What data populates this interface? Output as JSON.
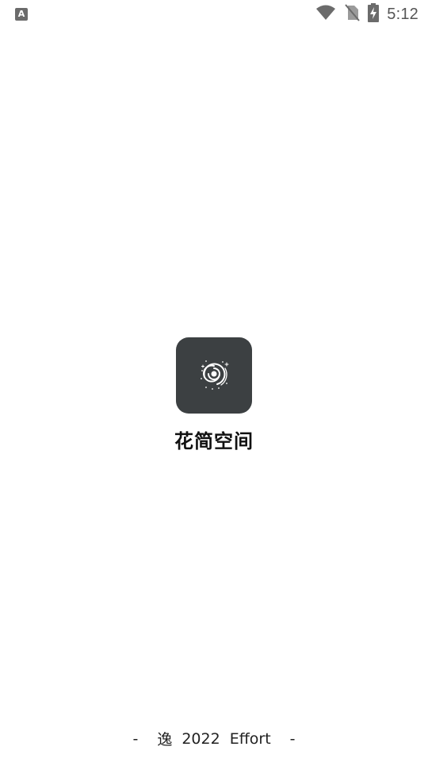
{
  "status_bar": {
    "left_icon_letter": "A",
    "icons": [
      "wifi-icon",
      "no-sim-icon",
      "battery-charging-icon"
    ],
    "time": "5:12"
  },
  "splash": {
    "app_icon": "galaxy-spiral-icon",
    "app_name": "花简空间"
  },
  "footer": {
    "dash_left": "-",
    "mark": "逸",
    "year": "2022",
    "word": "Effort",
    "dash_right": "-"
  },
  "colors": {
    "background": "#ffffff",
    "icon_bg": "#3c4042",
    "status_icons": "#6b6b6b"
  }
}
